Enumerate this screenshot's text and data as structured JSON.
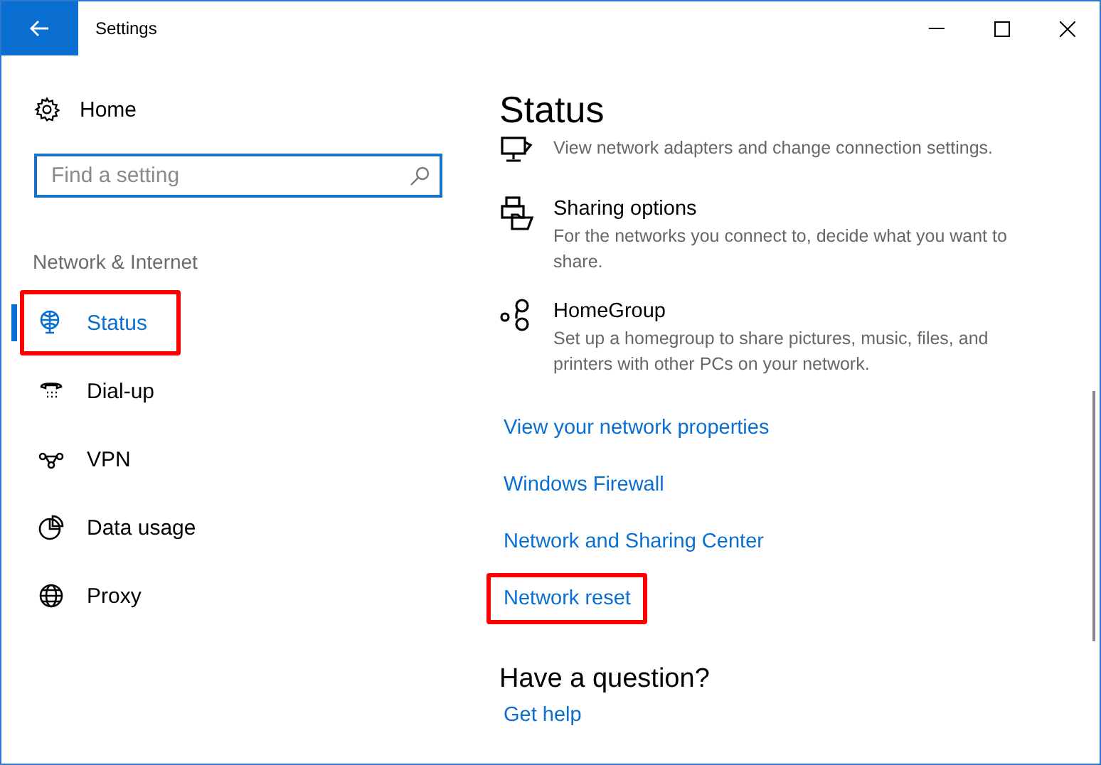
{
  "window": {
    "title": "Settings"
  },
  "sidebar": {
    "home": "Home",
    "search": {
      "placeholder": "Find a setting"
    },
    "section": "Network & Internet",
    "items": [
      {
        "label": "Status",
        "kind": "status",
        "selected": true,
        "annotated": true
      },
      {
        "label": "Dial-up",
        "kind": "dialup",
        "selected": false,
        "annotated": false
      },
      {
        "label": "VPN",
        "kind": "vpn",
        "selected": false,
        "annotated": false
      },
      {
        "label": "Data usage",
        "kind": "data",
        "selected": false,
        "annotated": false
      },
      {
        "label": "Proxy",
        "kind": "proxy",
        "selected": false,
        "annotated": false
      }
    ]
  },
  "content": {
    "title": "Status",
    "options": [
      {
        "kind": "adapter",
        "description": "View network adapters and change connection settings."
      },
      {
        "kind": "sharing",
        "title": "Sharing options",
        "description": "For the networks you connect to, decide what you want to share."
      },
      {
        "kind": "homegroup",
        "title": "HomeGroup",
        "description": "Set up a homegroup to share pictures, music, files, and printers with other PCs on your network."
      }
    ],
    "links": [
      {
        "label": "View your network properties",
        "annotated": false
      },
      {
        "label": "Windows Firewall",
        "annotated": false
      },
      {
        "label": "Network and Sharing Center",
        "annotated": false
      },
      {
        "label": "Network reset",
        "annotated": true
      }
    ],
    "question": "Have a question?",
    "help_link": "Get help"
  }
}
